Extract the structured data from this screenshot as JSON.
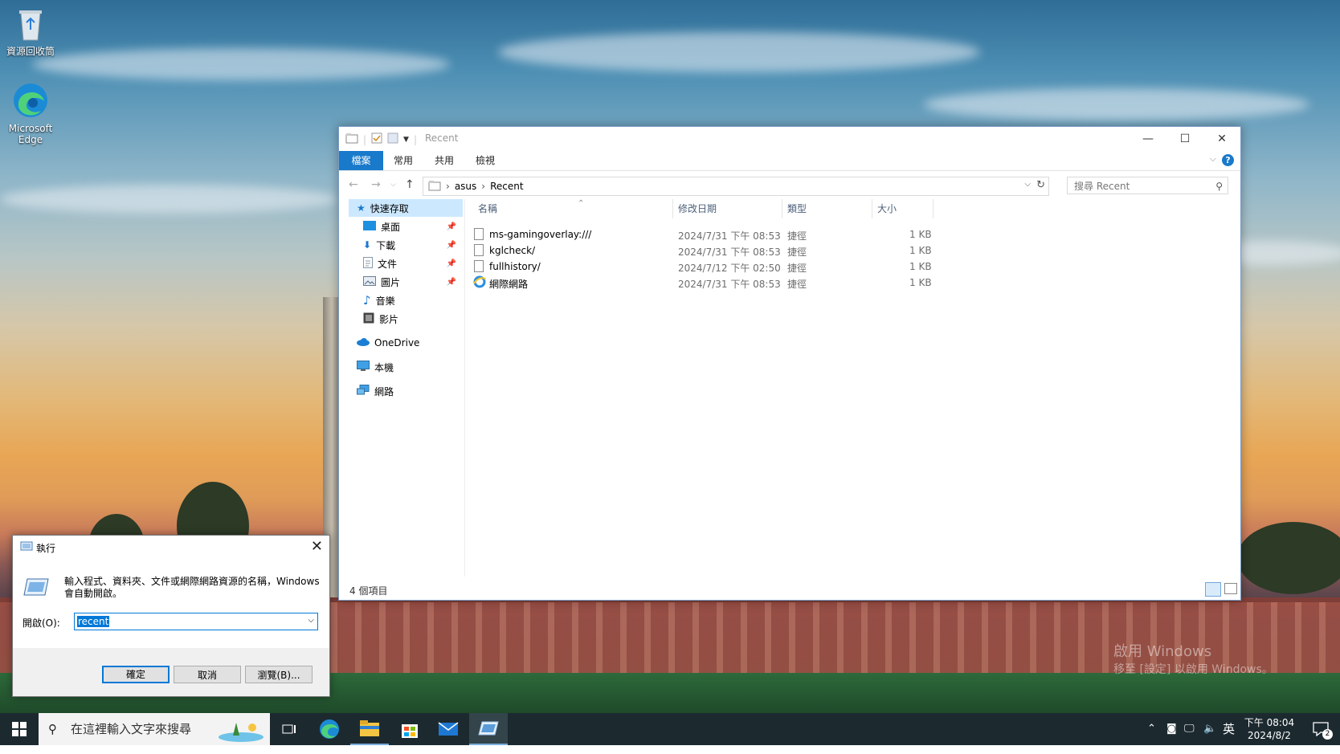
{
  "desktop": {
    "icons": [
      {
        "label": "資源回收筒",
        "icon": "recycle-bin-icon"
      },
      {
        "label": "Microsoft Edge",
        "icon": "edge-icon"
      }
    ],
    "watermark": {
      "line1": "啟用 Windows",
      "line2": "移至 [設定] 以啟用 Windows。"
    }
  },
  "explorer": {
    "title": "Recent",
    "ribbon_tabs": [
      "檔案",
      "常用",
      "共用",
      "檢視"
    ],
    "breadcrumb": [
      "asus",
      "Recent"
    ],
    "search_placeholder": "搜尋 Recent",
    "nav": {
      "quick_access": "快速存取",
      "items": [
        "桌面",
        "下載",
        "文件",
        "圖片",
        "音樂",
        "影片"
      ],
      "onedrive": "OneDrive",
      "this_pc": "本機",
      "network": "網路"
    },
    "columns": {
      "name": "名稱",
      "date": "修改日期",
      "type": "類型",
      "size": "大小"
    },
    "files": [
      {
        "name": "ms-gamingoverlay:///",
        "date": "2024/7/31 下午 08:53",
        "type": "捷徑",
        "size": "1 KB",
        "icon": "file-icon"
      },
      {
        "name": "kglcheck/",
        "date": "2024/7/31 下午 08:53",
        "type": "捷徑",
        "size": "1 KB",
        "icon": "file-icon"
      },
      {
        "name": "fullhistory/",
        "date": "2024/7/12 下午 02:50",
        "type": "捷徑",
        "size": "1 KB",
        "icon": "file-icon"
      },
      {
        "name": "網際網路",
        "date": "2024/7/31 下午 08:53",
        "type": "捷徑",
        "size": "1 KB",
        "icon": "ie-icon"
      }
    ],
    "status": "4 個項目"
  },
  "run_dialog": {
    "title": "執行",
    "description": "輸入程式、資料夾、文件或網際網路資源的名稱，Windows 會自動開啟。",
    "open_label": "開啟(O):",
    "input_value": "recent",
    "buttons": {
      "ok": "確定",
      "cancel": "取消",
      "browse": "瀏覽(B)..."
    }
  },
  "taskbar": {
    "search_placeholder": "在這裡輸入文字來搜尋",
    "ime": "英",
    "time": "下午 08:04",
    "date": "2024/8/2",
    "notification_count": "2"
  },
  "colors": {
    "accent": "#1979ca",
    "selection": "#0078d7",
    "taskbar": "#1c2a30"
  }
}
